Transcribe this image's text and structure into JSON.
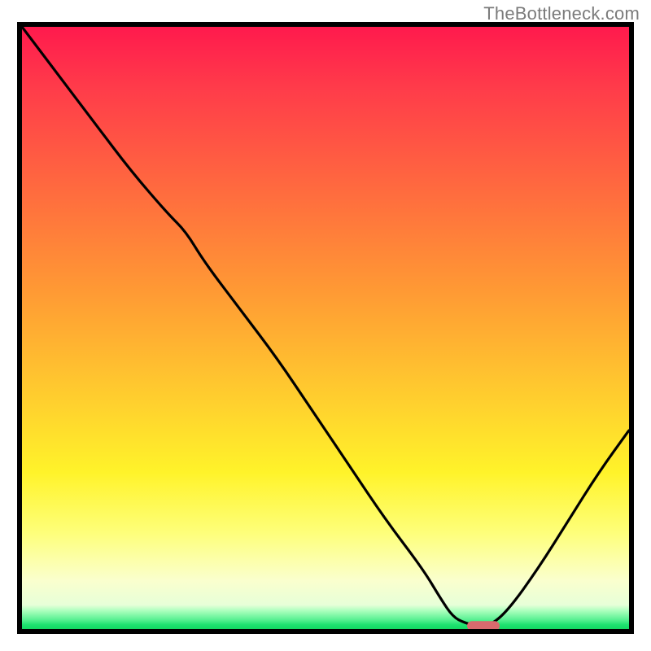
{
  "watermark": "TheBottleneck.com",
  "colors": {
    "frame": "#000000",
    "curve": "#000000",
    "marker": "#d96a6e"
  },
  "chart_data": {
    "type": "line",
    "title": "",
    "xlabel": "",
    "ylabel": "",
    "xlim": [
      0,
      100
    ],
    "ylim": [
      0,
      100
    ],
    "x": [
      0,
      6,
      12,
      18,
      24,
      27,
      30,
      36,
      42,
      48,
      54,
      60,
      66,
      69,
      71,
      73,
      75,
      77,
      80,
      85,
      90,
      95,
      100
    ],
    "y": [
      100,
      92,
      84,
      76,
      69,
      66,
      61,
      53,
      45,
      36,
      27,
      18,
      10,
      5,
      2,
      1,
      0.5,
      0.5,
      3,
      10,
      18,
      26,
      33
    ],
    "marker": {
      "x": 76,
      "y": 0.5,
      "label": ""
    },
    "note": "x and y are in percent of plot area; y=0 is bottom (green), y=100 is top (red). Values estimated from pixel positions; no axis ticks or labels are rendered in the image."
  }
}
